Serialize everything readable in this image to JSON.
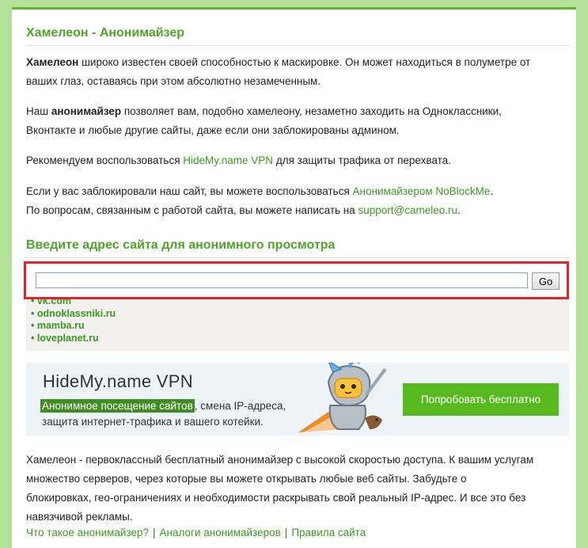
{
  "header": {
    "title": "Хамелеон - Анонимайзер"
  },
  "intro": {
    "p1_bold": "Хамелеон",
    "p1_rest_line1": " широко известен своей способностью к маскировке. Он может находиться в полуметре от",
    "p1_line2": "ваших глаз, оставаясь при этом абсолютно незамеченным.",
    "p2_start": "Наш ",
    "p2_bold": "анонимайзер",
    "p2_rest_line1": " позволяет вам, подобно хамелеону, незаметно заходить на Одноклассники,",
    "p2_line2": "Вконтакте и любые другие сайты, даже если они заблокированы админом.",
    "p3_start": "Рекомендуем воспользоваться ",
    "p3_link": "HideMy.name VPN",
    "p3_end": " для защиты трафика от перехвата.",
    "p4_start": "Если у вас заблокировали наш сайт, вы можете воспользоваться ",
    "p4_link": "Анонимайзером NoBlockMe",
    "p4_end": ".",
    "p5_start": "По вопросам, связанным с работой сайта, вы можете написать на ",
    "p5_link": "support@cameleo.ru",
    "p5_end": "."
  },
  "form": {
    "title": "Введите адрес сайта для анонимного просмотра",
    "input_value": "",
    "go_label": "Go",
    "sites": [
      "vk.com",
      "odnoklassniki.ru",
      "mamba.ru",
      "loveplanet.ru"
    ]
  },
  "banner": {
    "title": "HideMy.name VPN",
    "highlight": "Анонимное посещение сайтов",
    "line1_rest": ", смена IP-адреса,",
    "line2": "защита интернет-трафика и вашего котейки.",
    "button": "Попробовать бесплатно"
  },
  "description": {
    "line1": "Хамелеон - первоклассный бесплатный анонимайзер с высокой скоростью доступа. К вашим услугам",
    "line2": "множество серверов, через которые вы можете открывать любые веб сайты. Забудьте о",
    "line3": "блокировках, гео-ограничениях и необходимости раскрывать свой реальный IP-адрес. И все это без",
    "line4": "навязчивой рекламы."
  },
  "footer_links": [
    "Что такое анонимайзер?",
    "Аналоги анонимайзеров",
    "Правила сайта"
  ],
  "footer_separator": "|",
  "colors": {
    "brand_green": "#4fa52a",
    "link_green": "#3a9a1f",
    "background": "#b4e29a",
    "frame_red": "#e2232a",
    "button_green": "#58b81f"
  }
}
